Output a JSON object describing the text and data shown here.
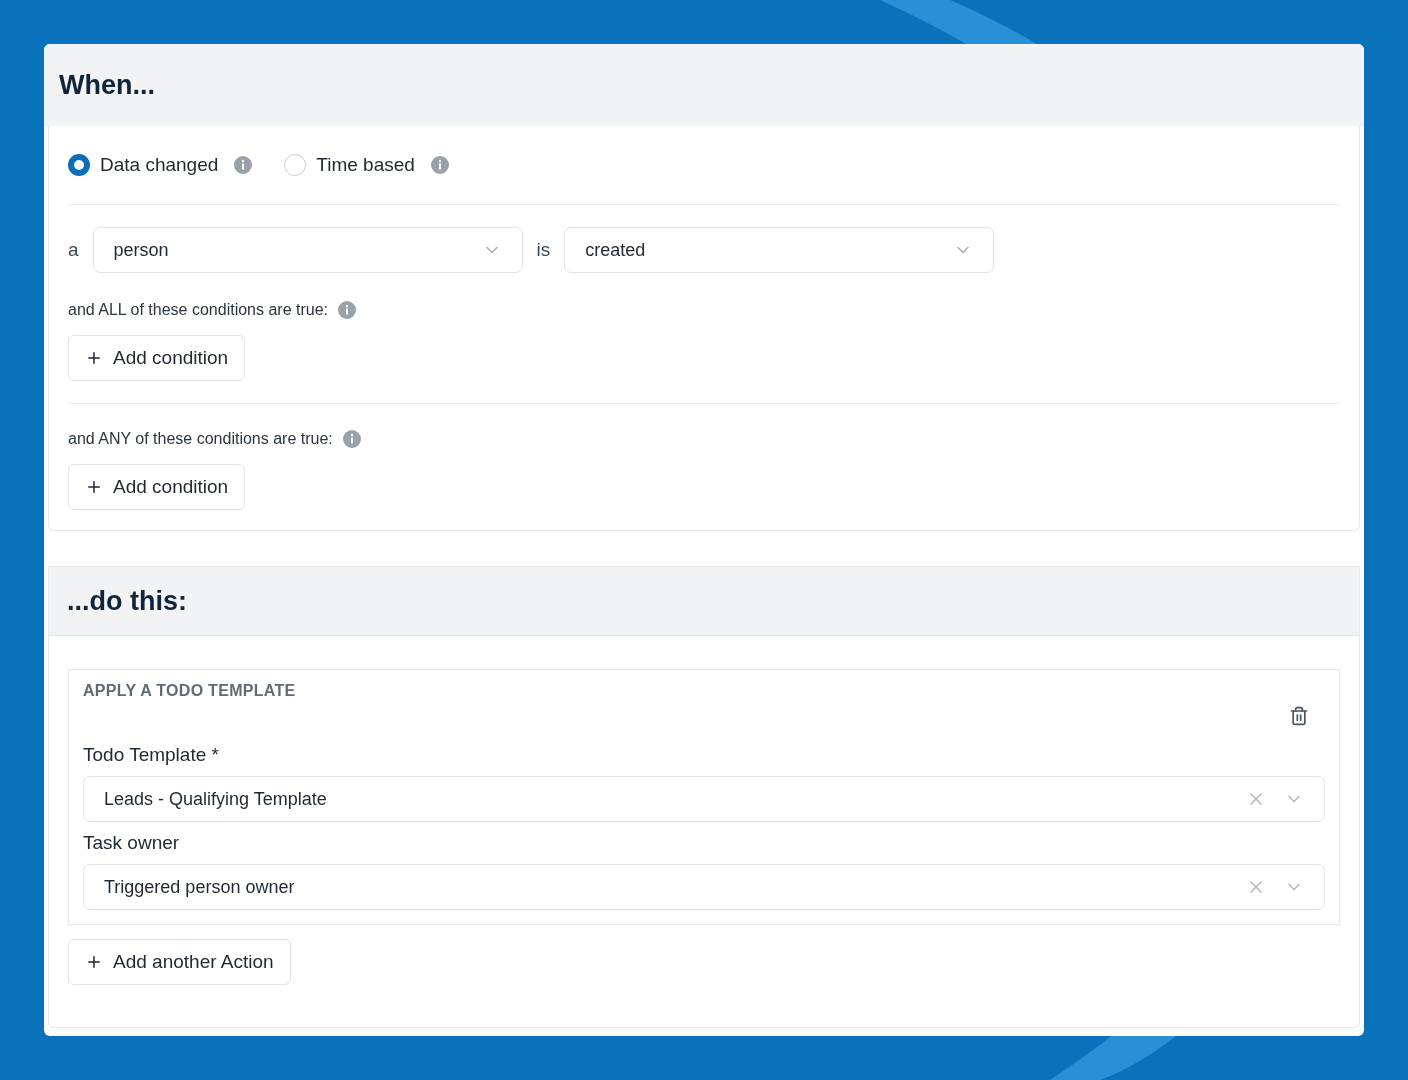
{
  "when": {
    "title": "When...",
    "triggers": [
      {
        "label": "Data changed",
        "selected": true
      },
      {
        "label": "Time based",
        "selected": false
      }
    ],
    "subject": {
      "prefix": "a",
      "value": "person"
    },
    "event": {
      "prefix": "is",
      "value": "created"
    },
    "condition_groups": [
      {
        "label": "and ALL of these conditions are true:",
        "button": "Add condition"
      },
      {
        "label": "and ANY of these conditions are true:",
        "button": "Add condition"
      }
    ]
  },
  "do_this": {
    "title": "...do this:",
    "actions": [
      {
        "heading": "APPLY A TODO TEMPLATE",
        "fields": [
          {
            "label": "Todo Template *",
            "value": "Leads - Qualifying Template"
          },
          {
            "label": "Task owner",
            "value": "Triggered person owner"
          }
        ]
      }
    ],
    "add_button": "Add another Action"
  }
}
